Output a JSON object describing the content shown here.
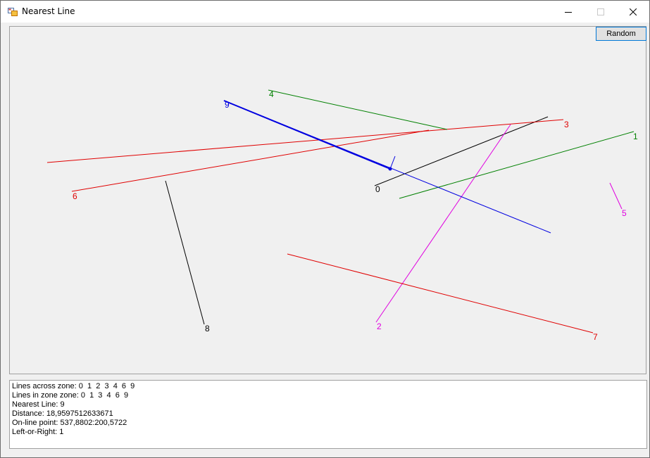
{
  "window": {
    "title": "Nearest Line"
  },
  "toolbar": {
    "random_label": "Random"
  },
  "lines": [
    {
      "label": "0",
      "color": "#000000"
    },
    {
      "label": "1",
      "color": "#008000"
    },
    {
      "label": "2",
      "color": "#e000e0"
    },
    {
      "label": "3",
      "color": "#e00000"
    },
    {
      "label": "4",
      "color": "#008000"
    },
    {
      "label": "5",
      "color": "#e000e0"
    },
    {
      "label": "6",
      "color": "#e00000"
    },
    {
      "label": "7",
      "color": "#e00000"
    },
    {
      "label": "8",
      "color": "#000000"
    },
    {
      "label": "9",
      "color": "#0000e0"
    }
  ],
  "highlight": {
    "nearest_line_color": "#0000e0",
    "point_color": "#0000e0"
  },
  "info": {
    "lines_across_zone": "Lines across zone: 0  1  2  3  4  6  9",
    "lines_in_zone": "Lines in zone zone: 0  1  3  4  6  9",
    "nearest_line": "Nearest Line: 9",
    "distance": "Distance: 18,9597512633671",
    "online_point": "On-line point: 537,8802:200,5722",
    "left_or_right": "Left-or-Right: 1"
  }
}
